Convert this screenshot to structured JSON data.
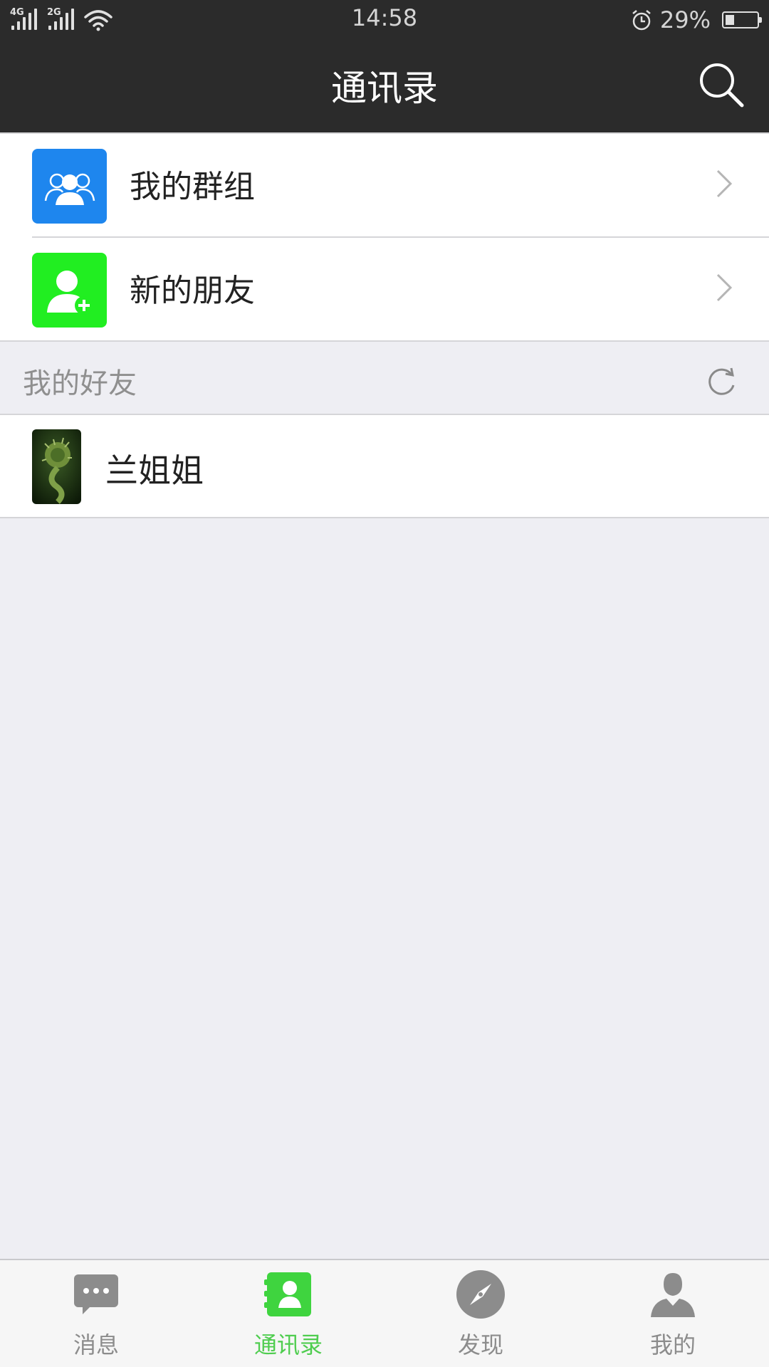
{
  "status_bar": {
    "network_1": "4G",
    "network_2": "2G",
    "time": "14:58",
    "battery_percent_text": "29%",
    "battery_level": 0.29
  },
  "header": {
    "title": "通讯录",
    "search_icon": "search-icon"
  },
  "menu": {
    "items": [
      {
        "label": "我的群组",
        "icon": "group-icon",
        "color": "#1e86ee"
      },
      {
        "label": "新的朋友",
        "icon": "add-friend-icon",
        "color": "#21ee21"
      }
    ]
  },
  "friends": {
    "section_title": "我的好友",
    "refresh_icon": "refresh-icon",
    "items": [
      {
        "name": "兰姐姐",
        "avatar": "fern-photo"
      }
    ]
  },
  "tab_bar": {
    "tabs": [
      {
        "label": "消息",
        "icon": "chat-bubble-icon",
        "active": false
      },
      {
        "label": "通讯录",
        "icon": "contacts-icon",
        "active": true
      },
      {
        "label": "发现",
        "icon": "compass-icon",
        "active": false
      },
      {
        "label": "我的",
        "icon": "profile-icon",
        "active": false
      }
    ],
    "active_color": "#4fcd4f",
    "inactive_color": "#8c8c8c"
  }
}
